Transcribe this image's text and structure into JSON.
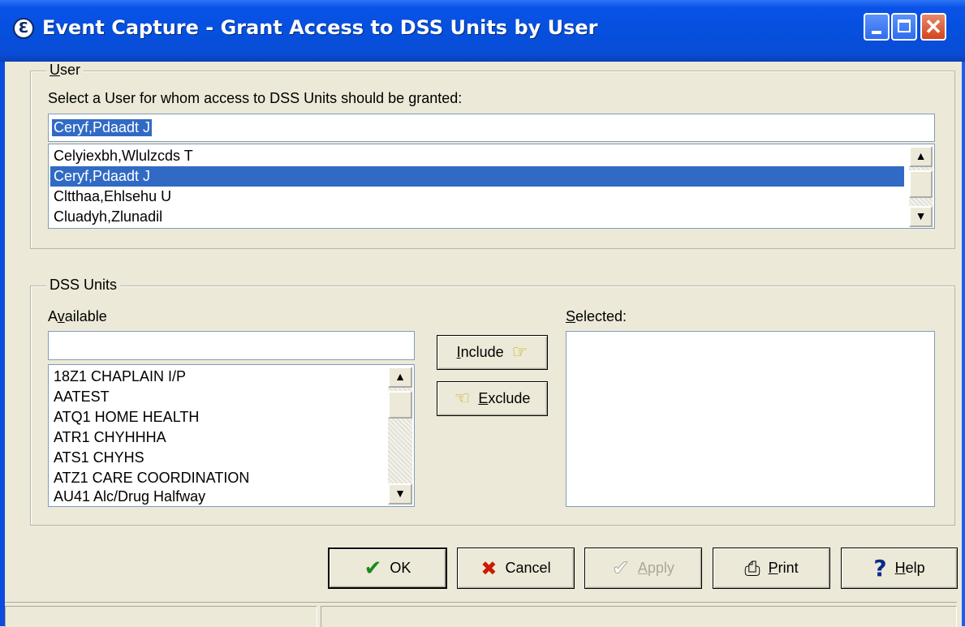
{
  "window": {
    "title": "Event Capture - Grant Access to DSS Units by User",
    "icon": "app-icon",
    "title_icon_glyph": "Ɛ"
  },
  "user_group": {
    "legend": "User",
    "legend_accel": "U",
    "legend_rest": "ser",
    "prompt": "Select a User for whom access to DSS Units should be granted:",
    "search_value": "Ceryf,Pdaadt J",
    "items": [
      {
        "label": "Celyiexbh,Wlulzcds T",
        "selected": false
      },
      {
        "label": "Ceryf,Pdaadt J",
        "selected": true
      },
      {
        "label": "Cltthaa,Ehlsehu U",
        "selected": false
      },
      {
        "label": "Cluadyh,Zlunadil",
        "selected": false
      }
    ]
  },
  "dss_group": {
    "legend": "DSS Units",
    "available": {
      "label": "Available",
      "label_pre": "A",
      "label_accel": "v",
      "label_rest": "ailable",
      "search_value": "",
      "items": [
        "18Z1 CHAPLAIN I/P",
        "AATEST",
        "ATQ1 HOME HEALTH",
        "ATR1 CHYHHHA",
        "ATS1 CHYHS",
        "ATZ1 CARE COORDINATION",
        "AU41 Alc/Drug Halfway"
      ]
    },
    "selected": {
      "label": "Selected:",
      "label_accel": "S",
      "label_rest": "elected:",
      "items": []
    },
    "include_button": {
      "label": "Include",
      "accel": "I",
      "rest": "nclude",
      "icon": "pointing-hand-right-icon"
    },
    "exclude_button": {
      "label": "Exclude",
      "accel": "E",
      "rest": "xclude",
      "icon": "pointing-hand-left-icon"
    }
  },
  "buttons": {
    "ok": {
      "label": "OK",
      "icon": "checkmark-icon",
      "color": "#1a8a1a"
    },
    "cancel": {
      "label": "Cancel",
      "icon": "x-icon",
      "color": "#cc1a00"
    },
    "apply": {
      "label": "Apply",
      "accel": "A",
      "rest": "pply",
      "icon": "checkmark-outline-icon",
      "disabled": true
    },
    "print": {
      "label": "Print",
      "accel": "P",
      "rest": "rint",
      "icon": "printer-icon"
    },
    "help": {
      "label": "Help",
      "accel": "H",
      "rest": "elp",
      "icon": "question-icon",
      "color": "#0a2a8a"
    }
  },
  "scroll_glyphs": {
    "up": "▲",
    "down": "▼"
  },
  "icon_glyphs": {
    "check": "✔",
    "x": "✖",
    "apply_check": "✔",
    "printer": "⎙",
    "question": "?",
    "hand_right": "☞",
    "hand_left": "☜",
    "close": "✕"
  },
  "colors": {
    "title_bar": "#0550dd",
    "selection": "#316ac5",
    "dialog_bg": "#ece9d8"
  }
}
